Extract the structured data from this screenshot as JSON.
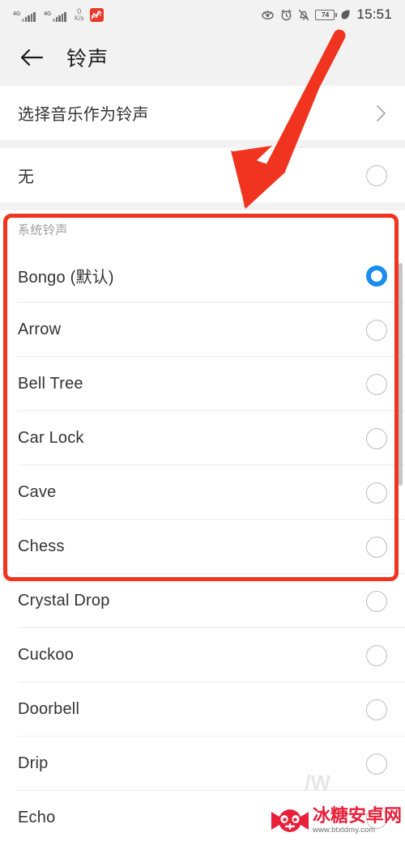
{
  "status_bar": {
    "signal_label": "4G",
    "signal_label_2": "4G",
    "net_speed_value": "0",
    "net_speed_unit": "K/s",
    "app_icon": "stocks-app-icon",
    "icons": [
      "eye-comfort-icon",
      "alarm-clock-icon",
      "bell-muted-icon"
    ],
    "battery_level": "74",
    "power_saving_icon": "leaf-icon",
    "time": "15:51"
  },
  "header": {
    "back_icon": "back-arrow-icon",
    "title": "铃声"
  },
  "pick_music": {
    "label": "选择音乐作为铃声",
    "chevron": "chevron-right-icon"
  },
  "none_option": {
    "label": "无",
    "selected": false
  },
  "section": {
    "header": "系统铃声"
  },
  "ringtones": [
    {
      "label": "Bongo (默认)",
      "selected": true
    },
    {
      "label": "Arrow",
      "selected": false
    },
    {
      "label": "Bell Tree",
      "selected": false
    },
    {
      "label": "Car Lock",
      "selected": false
    },
    {
      "label": "Cave",
      "selected": false
    },
    {
      "label": "Chess",
      "selected": false
    },
    {
      "label": "Crystal Drop",
      "selected": false
    },
    {
      "label": "Cuckoo",
      "selected": false
    },
    {
      "label": "Doorbell",
      "selected": false
    },
    {
      "label": "Drip",
      "selected": false
    },
    {
      "label": "Echo",
      "selected": false
    }
  ],
  "annotations": {
    "arrow_color": "#f0341f",
    "box_color": "#f0341f"
  },
  "watermark": {
    "site_name": "冰糖安卓网",
    "url": "www.btxtdmy.com",
    "logo": "candy-gamepad-logo"
  },
  "colors": {
    "accent": "#1a8cf0",
    "annotation_red": "#f0341f",
    "text_primary": "#333333",
    "text_secondary": "#9c9c9c",
    "background": "#f2f2f2",
    "card": "#ffffff"
  }
}
